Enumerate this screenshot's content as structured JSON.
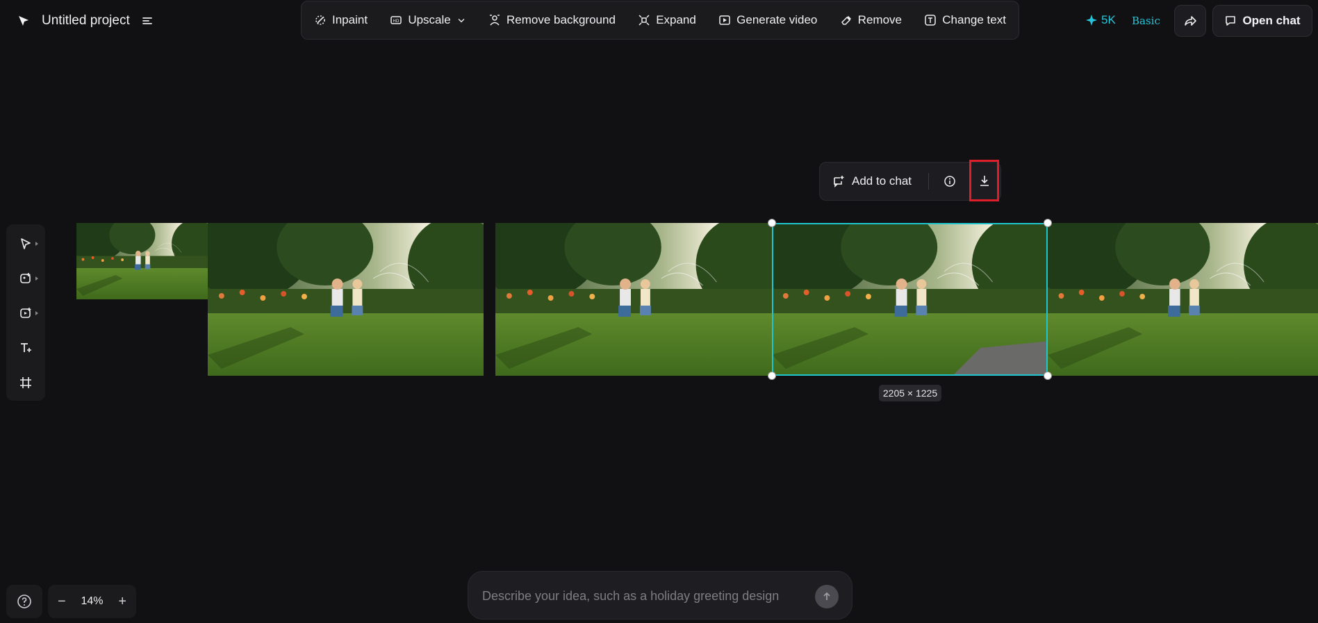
{
  "project": {
    "title": "Untitled project"
  },
  "toolbar": {
    "items": [
      {
        "label": "Inpaint",
        "icon": "inpaint-icon"
      },
      {
        "label": "Upscale",
        "icon": "hd-icon"
      },
      {
        "label": "Remove background",
        "icon": "person-cutout-icon"
      },
      {
        "label": "Expand",
        "icon": "expand-icon"
      },
      {
        "label": "Generate video",
        "icon": "play-icon"
      },
      {
        "label": "Remove",
        "icon": "eraser-icon"
      },
      {
        "label": "Change text",
        "icon": "text-box-icon"
      }
    ]
  },
  "account": {
    "credits": "5K",
    "plan": "Basic",
    "open_chat": "Open chat",
    "accent": "#26c6da"
  },
  "rail": {
    "items": [
      "select-tool",
      "image-add-tool",
      "video-add-tool",
      "text-tool",
      "frame-tool"
    ]
  },
  "canvas": {
    "selection_size": "2205 × 1225",
    "selection_color": "#20c6cf",
    "float_bar": {
      "add_to_chat": "Add to chat"
    },
    "highlight_color": "#e01e2a"
  },
  "zoom": {
    "value": "14%",
    "minus": "−",
    "plus": "+"
  },
  "prompt": {
    "placeholder": "Describe your idea, such as a holiday greeting design"
  }
}
